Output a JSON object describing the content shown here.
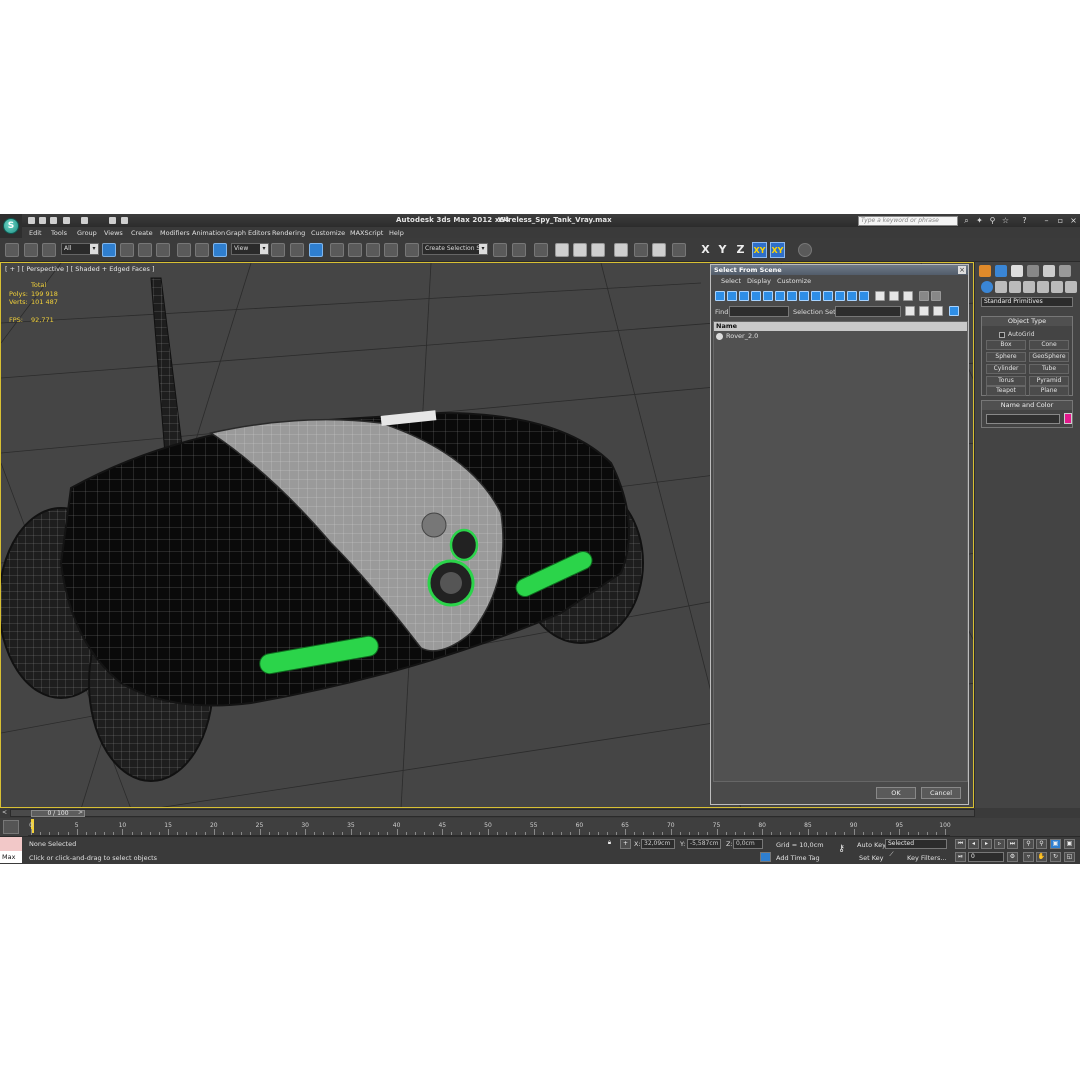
{
  "title": {
    "app": "Autodesk 3ds Max  2012 x64",
    "file": "Wireless_Spy_Tank_Vray.max",
    "search_placeholder": "Type a keyword or phrase"
  },
  "menu": [
    "Edit",
    "Tools",
    "Group",
    "Views",
    "Create",
    "Modifiers",
    "Animation",
    "Graph Editors",
    "Rendering",
    "Customize",
    "MAXScript",
    "Help"
  ],
  "toolbar": {
    "filter": "All",
    "ref_coord": "View",
    "selection_set": "Create Selection Se",
    "axes": [
      "X",
      "Y",
      "Z",
      "XY",
      "XY"
    ]
  },
  "viewport": {
    "label": "[ + ] [ Perspective ] [ Shaded + Edged Faces ]",
    "stats_header": "Total",
    "polys_label": "Polys:",
    "polys": "199 918",
    "verts_label": "Verts:",
    "verts": "101 487",
    "fps_label": "FPS:",
    "fps": "92,771"
  },
  "dialog": {
    "title": "Select From Scene",
    "menu": [
      "Select",
      "Display",
      "Customize"
    ],
    "find_label": "Find:",
    "selection_set_label": "Selection Set:",
    "column": "Name",
    "items": [
      "Rover_2.0"
    ],
    "ok": "OK",
    "cancel": "Cancel"
  },
  "command_panel": {
    "category": "Standard Primitives",
    "object_type": "Object Type",
    "autogrid": "AutoGrid",
    "primitives": [
      "Box",
      "Cone",
      "Sphere",
      "GeoSphere",
      "Cylinder",
      "Tube",
      "Torus",
      "Pyramid",
      "Teapot",
      "Plane"
    ],
    "name_and_color": "Name and Color",
    "object_color": "#e2198c"
  },
  "timeline": {
    "slider": "0 / 100",
    "ticks": [
      "0",
      "5",
      "10",
      "15",
      "20",
      "25",
      "30",
      "35",
      "40",
      "45",
      "50",
      "55",
      "60",
      "65",
      "70",
      "75",
      "80",
      "85",
      "90",
      "95",
      "100"
    ]
  },
  "status": {
    "maxscript": "Max",
    "selection": "None Selected",
    "prompt": "Click or click-and-drag to select objects",
    "x_label": "X:",
    "x": "32,09cm",
    "y_label": "Y:",
    "y": "-5,587cm",
    "z_label": "Z:",
    "z": "0,0cm",
    "grid": "Grid = 10,0cm",
    "add_time_tag": "Add Time Tag",
    "auto_key": "Auto Key",
    "set_key": "Set Key",
    "key_mode": "Selected",
    "key_filters": "Key Filters...",
    "frame": "0"
  },
  "colors": {
    "accent": "#2f7fd0",
    "glow": "#2bd44a",
    "stats": "#f3d23a"
  }
}
